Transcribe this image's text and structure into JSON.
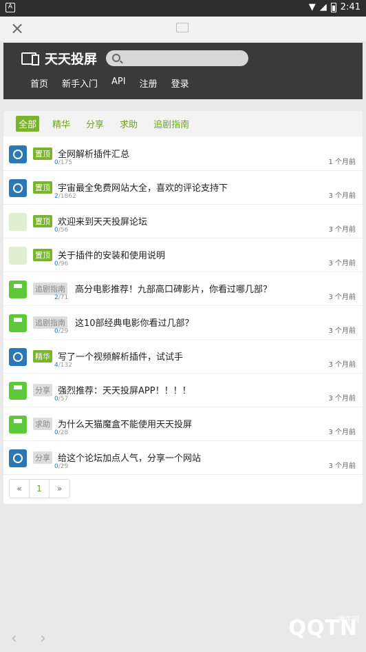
{
  "status": {
    "left_icon": "A",
    "time": "2:41"
  },
  "header": {
    "logo_text": "天天投屏",
    "nav": [
      "首页",
      "新手入门",
      "API",
      "注册",
      "登录"
    ]
  },
  "tabs": [
    "全部",
    "精华",
    "分享",
    "求助",
    "追剧指南"
  ],
  "topics": [
    {
      "avatar": "blue",
      "tag": "置顶",
      "tag_style": "top",
      "title": "全网解析插件汇总",
      "replies": "0",
      "views": "175",
      "time": "1 个月前"
    },
    {
      "avatar": "blue",
      "tag": "置顶",
      "tag_style": "top",
      "title": "宇宙最全免费网站大全，喜欢的评论支持下",
      "replies": "2",
      "views": "1862",
      "time": "3 个月前"
    },
    {
      "avatar": "pix",
      "tag": "置顶",
      "tag_style": "top",
      "title": "欢迎来到天天投屏论坛",
      "replies": "0",
      "views": "56",
      "time": "3 个月前"
    },
    {
      "avatar": "pix",
      "tag": "置顶",
      "tag_style": "top",
      "title": "关于插件的安装和使用说明",
      "replies": "0",
      "views": "96",
      "time": "3 个月前"
    },
    {
      "avatar": "green",
      "tag": "追剧指南",
      "tag_style": "gray",
      "title": "高分电影推荐！九部高口碑影片，你看过哪几部？",
      "replies": "2",
      "views": "71",
      "time": "3 个月前"
    },
    {
      "avatar": "green",
      "tag": "追剧指南",
      "tag_style": "gray",
      "title": "这10部经典电影你看过几部？",
      "replies": "0",
      "views": "29",
      "time": "3 个月前"
    },
    {
      "avatar": "blue",
      "tag": "精华",
      "tag_style": "top",
      "title": "写了一个视频解析插件，试试手",
      "replies": "4",
      "views": "132",
      "time": "3 个月前"
    },
    {
      "avatar": "green",
      "tag": "分享",
      "tag_style": "gray",
      "title": "强烈推荐：天天投屏APP！！！！",
      "replies": "0",
      "views": "57",
      "time": "3 个月前"
    },
    {
      "avatar": "green",
      "tag": "求助",
      "tag_style": "gray",
      "title": "为什么天猫魔盒不能使用天天投屏",
      "replies": "0",
      "views": "28",
      "time": "3 个月前"
    },
    {
      "avatar": "blue",
      "tag": "分享",
      "tag_style": "gray",
      "title": "给这个论坛加点人气，分享一个网站",
      "replies": "0",
      "views": "29",
      "time": "3 个月前"
    }
  ],
  "pager": {
    "prev": "«",
    "current": "1",
    "next": "»"
  },
  "watermark": {
    "small": "腾牛网",
    "big": "QQTN"
  }
}
